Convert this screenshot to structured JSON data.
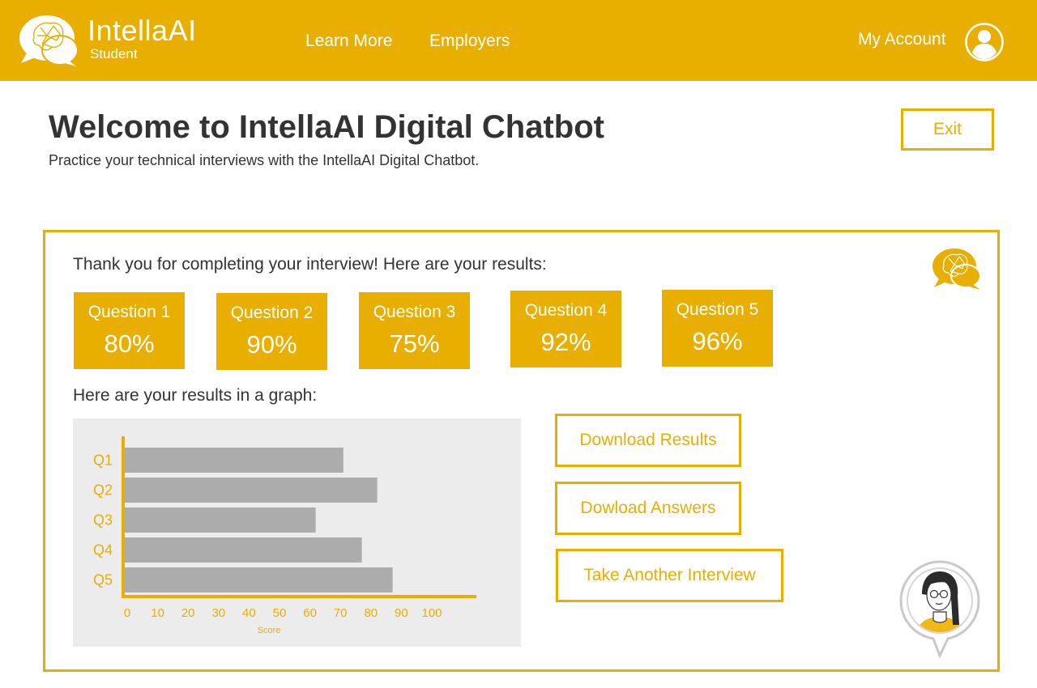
{
  "header": {
    "brand_name": "IntellaAI",
    "brand_sub": "Student",
    "nav": [
      {
        "label": "Learn More"
      },
      {
        "label": "Employers"
      }
    ],
    "account_label": "My Account",
    "logo_icon": "brain-chat-bubble-icon",
    "account_icon": "user-avatar-icon",
    "background_color": "#e8ae00"
  },
  "intro": {
    "title": "Welcome to IntellaAI Digital Chatbot",
    "subtitle": "Practice your technical interviews with the IntellaAI Digital Chatbot.",
    "exit_label": "Exit"
  },
  "results": {
    "thanks_text": "Thank you for completing your interview! Here are your results:",
    "cards": [
      {
        "title": "Question 1",
        "score": "80%"
      },
      {
        "title": "Question 2",
        "score": "90%"
      },
      {
        "title": "Question 3",
        "score": "75%"
      },
      {
        "title": "Question 4",
        "score": "92%"
      },
      {
        "title": "Question 5",
        "score": "96%"
      }
    ],
    "graph_label": "Here are your results in a graph:",
    "actions": {
      "download_results": "Download Results",
      "download_answers": "Dowload Answers",
      "take_another": "Take Another Interview"
    },
    "assistant_icon": "assistant-avatar-icon",
    "panel_icon": "brain-chat-bubble-icon"
  },
  "chart_data": {
    "type": "bar",
    "orientation": "horizontal",
    "categories": [
      "Q1",
      "Q2",
      "Q3",
      "Q4",
      "Q5"
    ],
    "values": [
      71,
      82,
      62,
      77,
      87
    ],
    "xlabel": "Score",
    "ylabel": "",
    "xticks": [
      "0",
      "10",
      "20",
      "30",
      "40",
      "50",
      "60",
      "70",
      "80",
      "90",
      "100"
    ],
    "xlim": [
      0,
      115
    ],
    "grid": false,
    "bar_color": "#acacac",
    "axis_color": "#e8ae00",
    "background_color": "#ececec"
  }
}
